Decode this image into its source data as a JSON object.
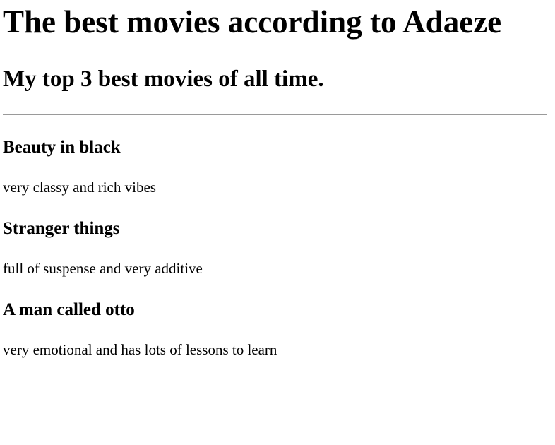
{
  "header": {
    "title": "The best movies according to Adaeze",
    "subtitle": "My top 3 best movies of all time."
  },
  "movies": [
    {
      "title": "Beauty in black",
      "description": "very classy and rich vibes"
    },
    {
      "title": "Stranger things",
      "description": "full of suspense and very additive"
    },
    {
      "title": "A man called otto",
      "description": "very emotional and has lots of lessons to learn"
    }
  ],
  "colors": {
    "background": "#ffffff",
    "text": "#000000",
    "divider": "#9a9a9a"
  }
}
